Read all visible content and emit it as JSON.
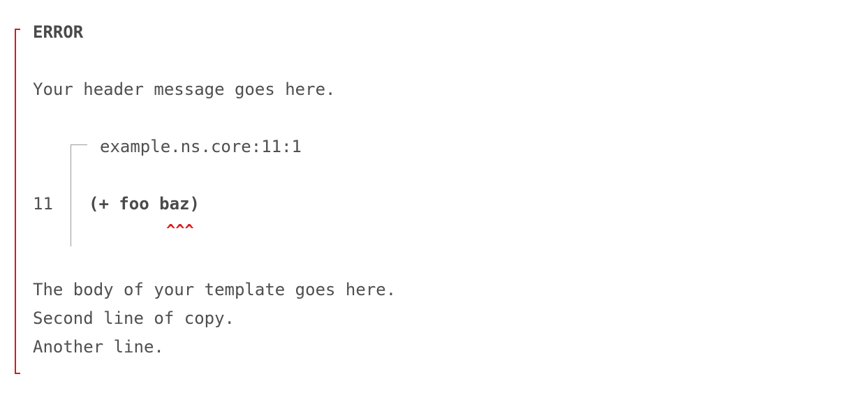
{
  "error": {
    "label": "ERROR",
    "header_message": "Your header message goes here.",
    "location": "example.ns.core:11:1",
    "line_number": "11",
    "code": "(+ foo baz)",
    "caret_marker": "^^^",
    "body_lines": [
      "The body of your template goes here.",
      "Second line of copy.",
      "Another line."
    ]
  },
  "colors": {
    "accent": "#d11d1d",
    "text": "#4f4f4f",
    "frame": "#9a9a9a"
  }
}
